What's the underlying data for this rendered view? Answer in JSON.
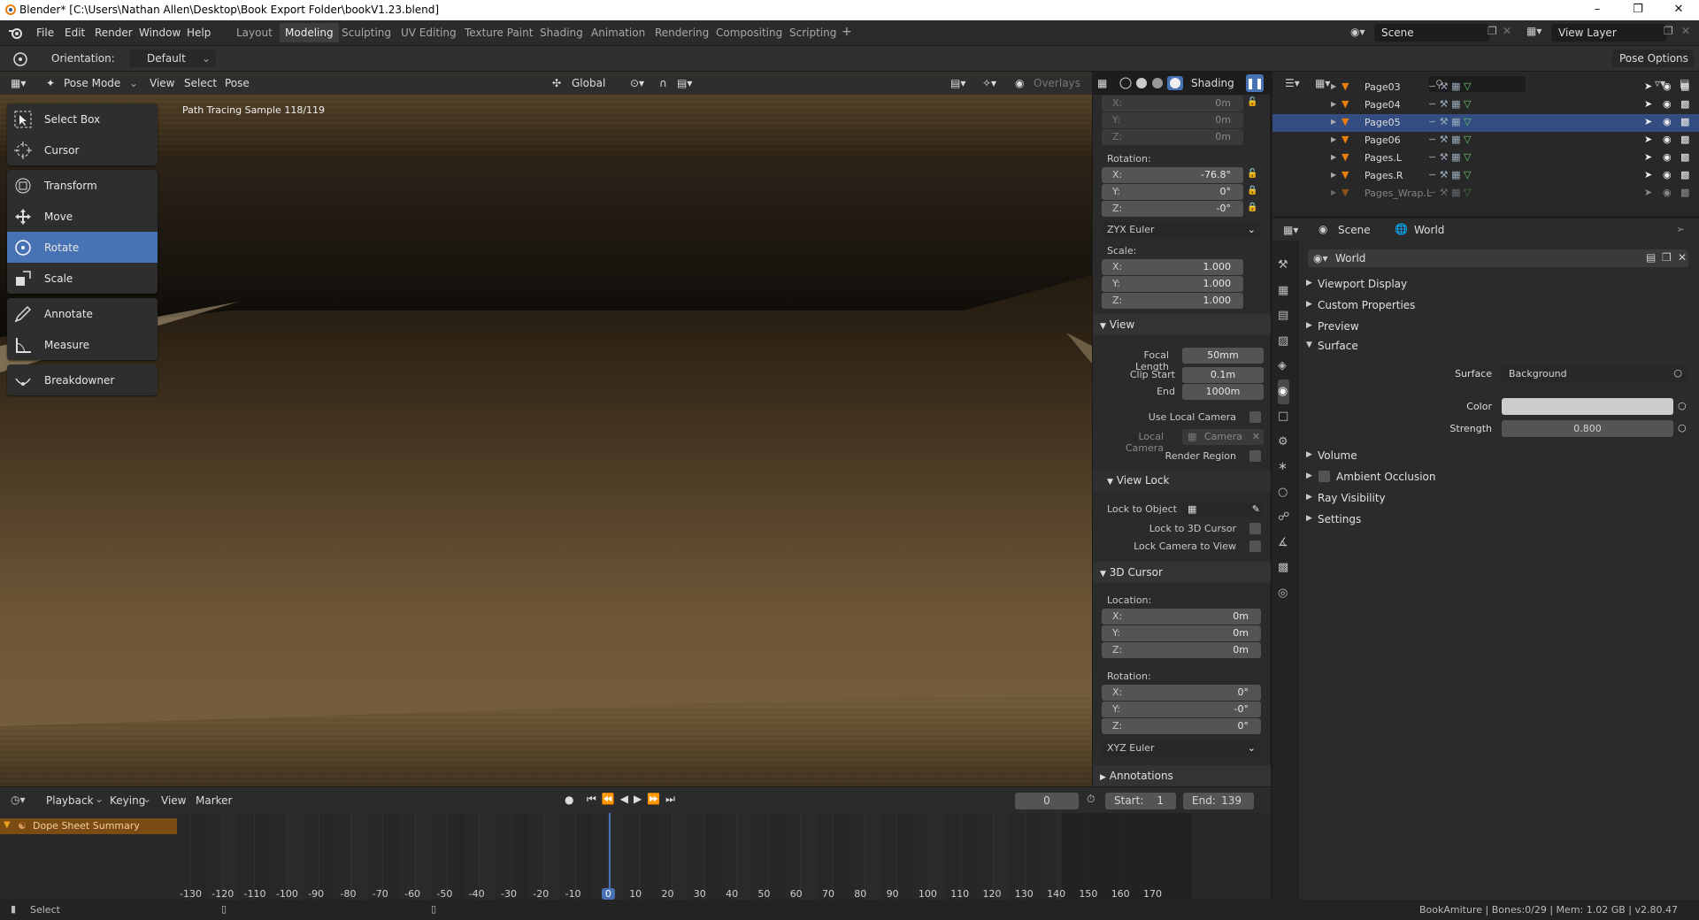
{
  "window": {
    "title": "Blender* [C:\\Users\\Nathan Allen\\Desktop\\Book Export Folder\\bookV1.23.blend]"
  },
  "menu": {
    "items": [
      "File",
      "Edit",
      "Render",
      "Window",
      "Help"
    ]
  },
  "workspaces": [
    "Layout",
    "Modeling",
    "Sculpting",
    "UV Editing",
    "Texture Paint",
    "Shading",
    "Animation",
    "Rendering",
    "Compositing",
    "Scripting"
  ],
  "active_workspace": "Modeling",
  "scene": {
    "name": "Scene",
    "view_layer": "View Layer"
  },
  "tool_header": {
    "orientation_label": "Orientation:",
    "orientation_value": "Default",
    "pose_options": "Pose Options"
  },
  "viewport_header": {
    "mode": "Pose Mode",
    "view": "View",
    "select": "Select",
    "pose": "Pose",
    "transform": "Global",
    "overlays": "Overlays",
    "shading": "Shading"
  },
  "viewport": {
    "render_info": "Path Tracing Sample 118/119"
  },
  "tools": {
    "groups": [
      [
        {
          "name": "select-box-tool",
          "label": "Select Box",
          "active": false
        },
        {
          "name": "cursor-tool",
          "label": "Cursor",
          "active": false
        }
      ],
      [
        {
          "name": "transform-tool",
          "label": "Transform",
          "active": false
        },
        {
          "name": "move-tool",
          "label": "Move",
          "active": false
        },
        {
          "name": "rotate-tool",
          "label": "Rotate",
          "active": true
        },
        {
          "name": "scale-tool",
          "label": "Scale",
          "active": false
        }
      ],
      [
        {
          "name": "annotate-tool",
          "label": "Annotate",
          "active": false
        },
        {
          "name": "measure-tool",
          "label": "Measure",
          "active": false
        }
      ],
      [
        {
          "name": "breakdowner-tool",
          "label": "Breakdowner",
          "active": false
        }
      ]
    ]
  },
  "npanel": {
    "location": {
      "x": "0m",
      "y": "0m",
      "z": "0m"
    },
    "rotation_label": "Rotation:",
    "rotation": {
      "x": "-76.8°",
      "y": "0°",
      "z": "-0°"
    },
    "rotation_mode": "ZYX Euler",
    "scale_label": "Scale:",
    "scale": {
      "x": "1.000",
      "y": "1.000",
      "z": "1.000"
    },
    "view": {
      "title": "View",
      "focal_length_label": "Focal Length",
      "focal_length": "50mm",
      "clip_start_label": "Clip Start",
      "clip_start": "0.1m",
      "end_label": "End",
      "end": "1000m",
      "use_local_camera": "Use Local Camera",
      "local_camera_label": "Local Camera",
      "local_camera": "Camera",
      "render_region": "Render Region"
    },
    "view_lock": {
      "title": "View Lock",
      "lock_to_object": "Lock to Object",
      "lock_to_cursor": "Lock to 3D Cursor",
      "lock_camera": "Lock Camera to View"
    },
    "cursor": {
      "title": "3D Cursor",
      "location_label": "Location:",
      "location": {
        "x": "0m",
        "y": "0m",
        "z": "0m"
      },
      "rotation_label": "Rotation:",
      "rotation": {
        "x": "0°",
        "y": "-0°",
        "z": "0°"
      },
      "rotation_mode": "XYZ Euler"
    },
    "annotations": "Annotations"
  },
  "outliner": {
    "rows": [
      {
        "name": "Page03",
        "selected": false
      },
      {
        "name": "Page04",
        "selected": false
      },
      {
        "name": "Page05",
        "selected": true
      },
      {
        "name": "Page06",
        "selected": false
      },
      {
        "name": "Pages.L",
        "selected": false
      },
      {
        "name": "Pages.R",
        "selected": false
      },
      {
        "name": "Pages_Wrap.L",
        "selected": false
      }
    ]
  },
  "properties": {
    "breadcrumb_scene": "Scene",
    "breadcrumb_world": "World",
    "world_name": "World",
    "panels_top": [
      "Viewport Display",
      "Custom Properties",
      "Preview"
    ],
    "surface": {
      "title": "Surface",
      "surface_label": "Surface",
      "surface_value": "Background",
      "color_label": "Color",
      "strength_label": "Strength",
      "strength_value": "0.800"
    },
    "panels_bottom": [
      "Volume",
      "Ambient Occlusion",
      "Ray Visibility",
      "Settings"
    ]
  },
  "timeline": {
    "menus": [
      "Playback",
      "Keying",
      "View",
      "Marker"
    ],
    "current_frame": "0",
    "start_label": "Start:",
    "start": "1",
    "end_label": "End:",
    "end": "139",
    "summary": "Dope Sheet Summary",
    "ticks": [
      "-130",
      "-120",
      "-110",
      "-100",
      "-90",
      "-80",
      "-70",
      "-60",
      "-50",
      "-40",
      "-30",
      "-20",
      "-10",
      "0",
      "10",
      "20",
      "30",
      "40",
      "50",
      "60",
      "70",
      "80",
      "90",
      "100",
      "110",
      "120",
      "130",
      "140",
      "150",
      "160",
      "170"
    ]
  },
  "status": {
    "left": "Select",
    "right": "BookAmiture | Bones:0/29 | Mem: 1.02 GB | v2.80.47"
  },
  "colors": {
    "accent": "#4772b3",
    "selection": "#334d80",
    "orange": "#e87d0d",
    "active_frame": "#4772b3"
  }
}
